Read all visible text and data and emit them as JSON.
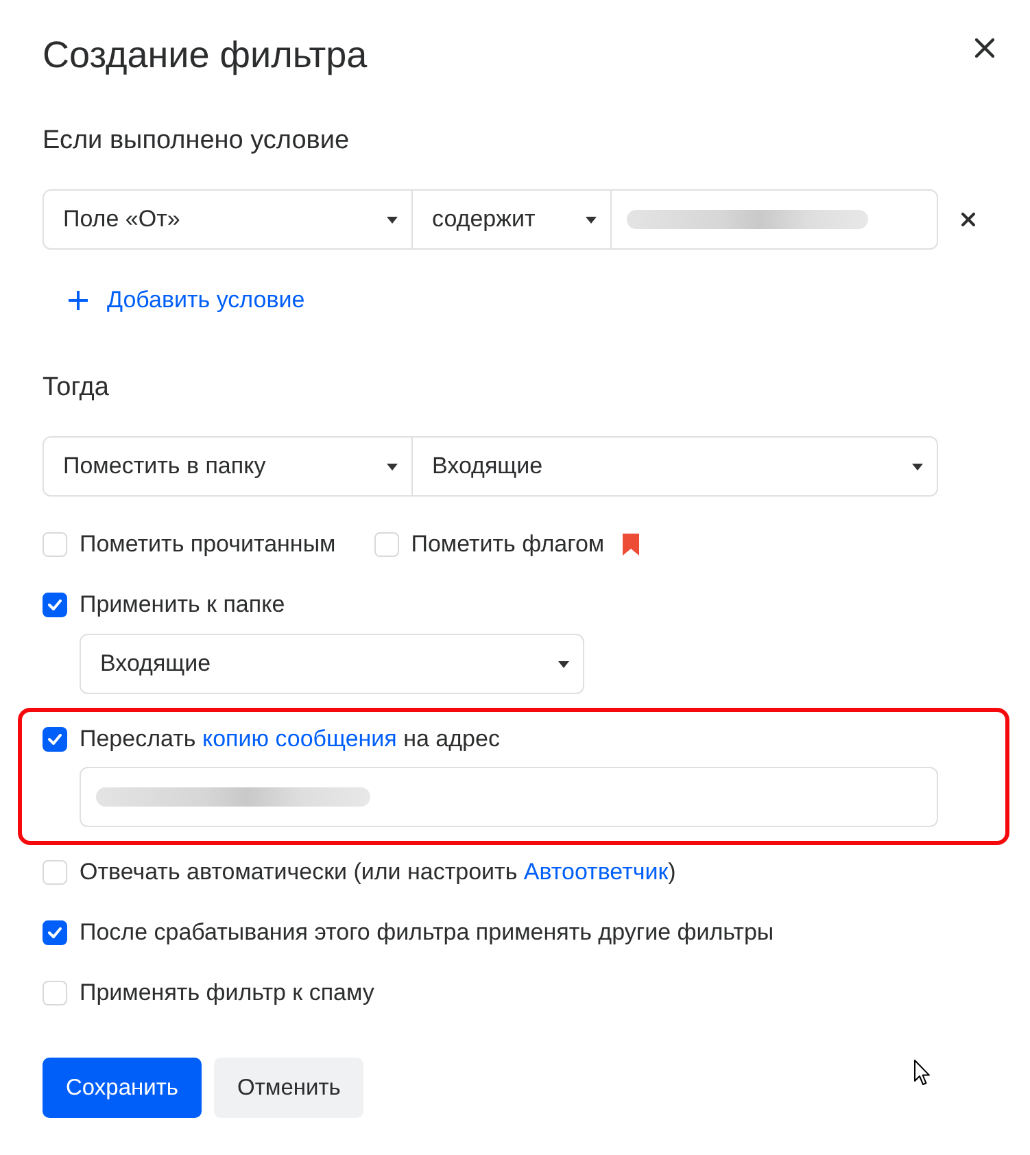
{
  "dialog": {
    "title": "Создание фильтра"
  },
  "conditions": {
    "heading": "Если выполнено условие",
    "rows": [
      {
        "field": "Поле «От»",
        "operator": "содержит",
        "value_blurred": true
      }
    ],
    "add_link": "Добавить условие"
  },
  "actions": {
    "heading": "Тогда",
    "action": "Поместить в папку",
    "folder": "Входящие"
  },
  "option_rows": [
    {
      "highlighted": false,
      "items": [
        {
          "kind": "plain",
          "checked": false,
          "parts": [
            {
              "text": "Пометить прочитанным",
              "link": false
            }
          ]
        },
        {
          "kind": "flag",
          "checked": false,
          "parts": [
            {
              "text": "Пометить флагом",
              "link": false
            }
          ]
        }
      ]
    },
    {
      "highlighted": false,
      "items": [
        {
          "kind": "folder",
          "checked": true,
          "parts": [
            {
              "text": "Применить к папке",
              "link": false
            }
          ],
          "folder": "Входящие"
        }
      ]
    },
    {
      "highlighted": true,
      "items": [
        {
          "kind": "forward",
          "checked": true,
          "parts": [
            {
              "text": "Переслать ",
              "link": false
            },
            {
              "text": "копию сообщения",
              "link": true
            },
            {
              "text": " на адрес",
              "link": false
            }
          ],
          "address_blurred": true
        }
      ]
    },
    {
      "highlighted": false,
      "items": [
        {
          "kind": "plain",
          "checked": false,
          "parts": [
            {
              "text": "Отвечать автоматически (или настроить ",
              "link": false
            },
            {
              "text": "Автоответчик",
              "link": true
            },
            {
              "text": ")",
              "link": false
            }
          ]
        }
      ]
    },
    {
      "highlighted": false,
      "items": [
        {
          "kind": "plain",
          "checked": true,
          "parts": [
            {
              "text": "После срабатывания этого фильтра применять другие фильтры",
              "link": false
            }
          ]
        }
      ]
    },
    {
      "highlighted": false,
      "items": [
        {
          "kind": "plain",
          "checked": false,
          "parts": [
            {
              "text": "Применять фильтр к спаму",
              "link": false
            }
          ]
        }
      ]
    }
  ],
  "buttons": [
    {
      "label": "Сохранить",
      "kind": "primary"
    },
    {
      "label": "Отменить",
      "kind": "secondary"
    }
  ]
}
